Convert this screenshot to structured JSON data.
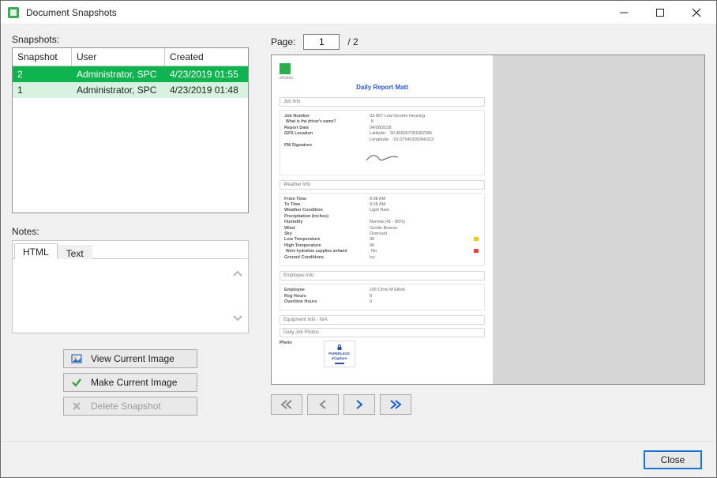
{
  "titlebar": {
    "title": "Document Snapshots"
  },
  "left": {
    "snapshots_label": "Snapshots:",
    "headers": {
      "snapshot": "Snapshot",
      "user": "User",
      "created": "Created"
    },
    "rows": [
      {
        "id": "2",
        "user": "Administrator, SPC",
        "created": "4/23/2019 01:55",
        "selected": true
      },
      {
        "id": "1",
        "user": "Administrator, SPC",
        "created": "4/23/2019 01:48",
        "selected": false
      }
    ],
    "notes_label": "Notes:",
    "tabs": {
      "html": "HTML",
      "text": "Text"
    },
    "buttons": {
      "view": "View Current Image",
      "make": "Make Current Image",
      "delete": "Delete Snapshot"
    }
  },
  "right": {
    "page_label": "Page:",
    "page_value": "1",
    "page_total": "/ 2"
  },
  "doc": {
    "eforms": "eForms",
    "title": "Daily Report Matt",
    "sections": {
      "job": "Job Info",
      "weather": "Weather Info",
      "employee": "Employee Info",
      "equipment": "Equipment Info - N/A",
      "photos": "Daily Job Photos"
    },
    "job": {
      "job_number_k": "Job Number",
      "job_number_v": "03-067 Low Income Housing",
      "sub_q": "What is the driver's name?",
      "sub_a": "K",
      "report_date_k": "Report Date",
      "report_date_v": "04/08/2018",
      "gps_k": "GPS Location",
      "lat_k": "Latitude:",
      "lat_v": "30.466067091092386",
      "lon_k": "Longitude:",
      "lon_v": "-91.07540309346323",
      "pm_sig_k": "PM Signature"
    },
    "weather": {
      "from_k": "From Time",
      "from_v": "9:08 AM",
      "to_k": "To Time",
      "to_v": "9:28 AM",
      "cond_k": "Weather Condition",
      "cond_v": "Light Rain",
      "precip_k": "Precipitation (inches)",
      "humidity_k": "Humidity",
      "humidity_v": "Normal (41 - 80%)",
      "wind_k": "Wind",
      "wind_v": "Gentle Breeze",
      "sky_k": "Sky",
      "sky_v": "Overcast",
      "low_k": "Low Temperature",
      "low_v": "36",
      "high_k": "High Temperature",
      "high_v": "90",
      "hydration_k": "Were hydration supplies onhand",
      "hydration_v": "No",
      "ground_k": "Ground Conditions",
      "ground_v": "Icy"
    },
    "employee": {
      "emp_k": "Employee",
      "emp_v": "106  Chris M Elliott",
      "reg_k": "Reg Hours",
      "reg_v": "8",
      "ot_k": "Overtime Hours",
      "ot_v": "0"
    },
    "photos": {
      "photo_k": "Photo",
      "thumb1": "PAPERLESS",
      "thumb2": "eCapture"
    }
  },
  "footer": {
    "close": "Close"
  }
}
